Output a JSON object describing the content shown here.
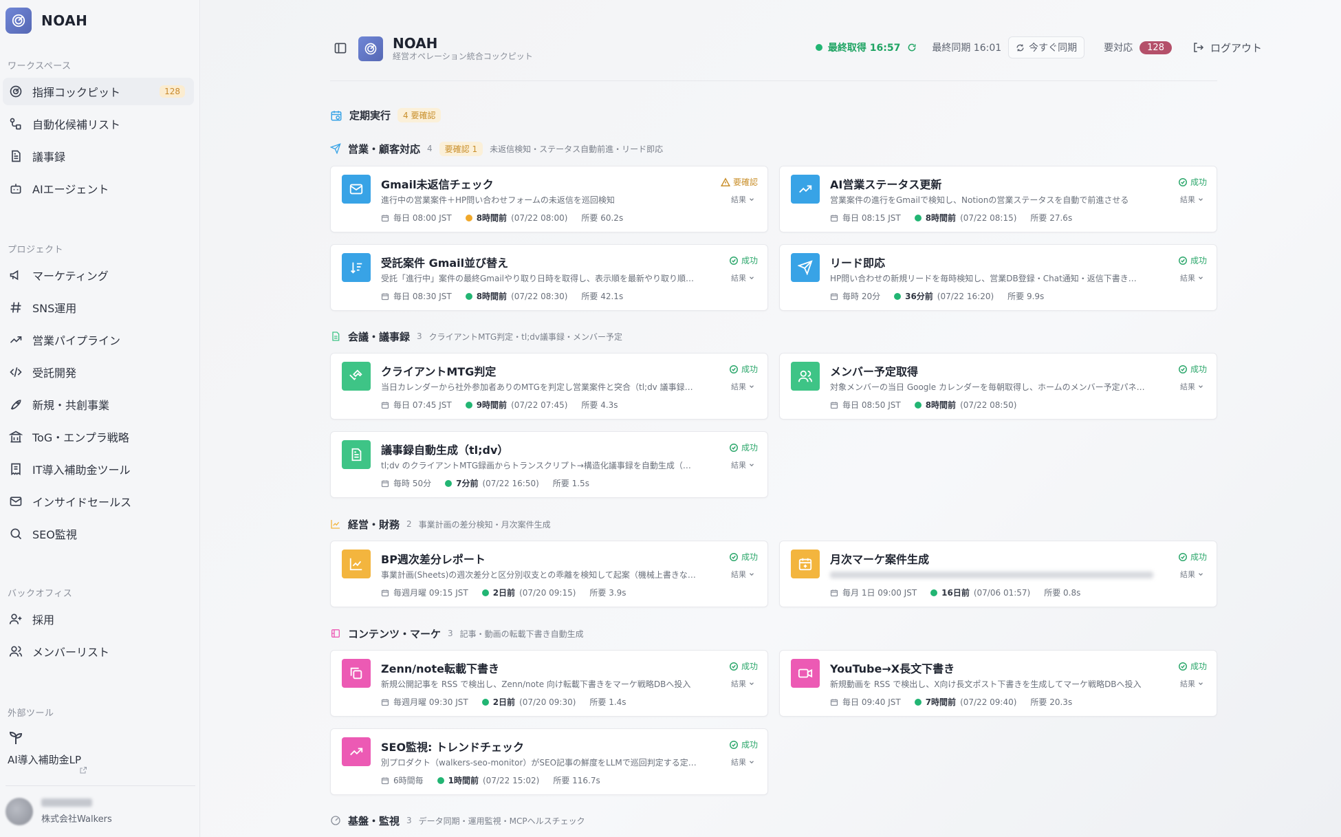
{
  "sidebar": {
    "brand": "NOAH",
    "sections": {
      "workspace": "ワークスペース",
      "project": "プロジェクト",
      "backoffice": "バックオフィス",
      "external": "外部ツール"
    },
    "workspace_items": [
      {
        "label": "指揮コックピット",
        "count": "128",
        "icon": "cockpit-icon"
      },
      {
        "label": "自動化候補リスト",
        "icon": "flow-icon"
      },
      {
        "label": "議事録",
        "icon": "document-icon"
      },
      {
        "label": "AIエージェント",
        "icon": "bot-icon"
      }
    ],
    "project_items": [
      {
        "label": "マーケティング",
        "icon": "megaphone-icon"
      },
      {
        "label": "SNS運用",
        "icon": "hash-icon"
      },
      {
        "label": "営業パイプライン",
        "icon": "trend-icon"
      },
      {
        "label": "受託開発",
        "icon": "code-icon"
      },
      {
        "label": "新規・共創事業",
        "icon": "rocket-icon"
      },
      {
        "label": "ToG・エンプラ戦略",
        "icon": "building-icon"
      },
      {
        "label": "IT導入補助金ツール",
        "icon": "receipt-icon"
      },
      {
        "label": "インサイドセールス",
        "icon": "mail-icon"
      },
      {
        "label": "SEO監視",
        "icon": "search-icon"
      }
    ],
    "backoffice_items": [
      {
        "label": "採用",
        "icon": "user-plus-icon"
      },
      {
        "label": "メンバーリスト",
        "icon": "users-icon"
      }
    ],
    "external_items": [
      {
        "label": "AI導入補助金LP",
        "icon": "sprout-icon"
      }
    ],
    "user": {
      "company": "株式会社Walkers"
    }
  },
  "header": {
    "title": "NOAH",
    "subtitle": "経営オペレーション統合コックピット",
    "last_fetch": "最終取得 16:57",
    "last_sync": "最終同期 16:01",
    "sync_now": "今すぐ同期",
    "needs_action_label": "要対応",
    "needs_action_count": "128",
    "logout": "ログアウト"
  },
  "schedule": {
    "title": "定期実行",
    "badge": "4 要確認"
  },
  "categories": [
    {
      "title": "営業・顧客対応",
      "count": "4",
      "badge": "要確認 1",
      "desc": "未返信検知・ステータス自動前進・リード即応"
    },
    {
      "title": "会議・議事録",
      "count": "3",
      "desc": "クライアントMTG判定・tl;dv議事録・メンバー予定"
    },
    {
      "title": "経営・財務",
      "count": "2",
      "desc": "事業計画の差分検知・月次案件生成"
    },
    {
      "title": "コンテンツ・マーケ",
      "count": "3",
      "desc": "記事・動画の転載下書き自動生成"
    },
    {
      "title": "基盤・監視",
      "count": "3",
      "desc": "データ同期・運用監視・MCPヘルスチェック"
    }
  ],
  "status": {
    "ok": "成功",
    "warn": "要確認",
    "result": "結果"
  },
  "cards": [
    {
      "title": "Gmail未返信チェック",
      "desc": "進行中の営業案件＋HP問い合わせフォームの未返信を巡回検知",
      "schedule": "毎日 08:00 JST",
      "last": "8時間前",
      "last_time": "(07/22 08:00)",
      "duration": "所要 60.2s",
      "status": "warn",
      "icon": "mail-icon",
      "color": "#38a3e6"
    },
    {
      "title": "AI営業ステータス更新",
      "desc": "営業案件の進行をGmailで検知し、Notionの営業ステータスを自動で前進させる",
      "schedule": "毎日 08:15 JST",
      "last": "8時間前",
      "last_time": "(07/22 08:15)",
      "duration": "所要 27.6s",
      "status": "ok",
      "icon": "trend-icon",
      "color": "#38a3e6"
    },
    {
      "title": "受託案件 Gmail並び替え",
      "desc": "受託「進行中」案件の最終Gmailやり取り日時を取得し、表示順を最新やり取り順…",
      "schedule": "毎日 08:30 JST",
      "last": "8時間前",
      "last_time": "(07/22 08:30)",
      "duration": "所要 42.1s",
      "status": "ok",
      "icon": "sort-icon",
      "color": "#38a3e6"
    },
    {
      "title": "リード即応",
      "desc": "HP問い合わせの新規リードを毎時検知し、営業DB登録・Chat通知・返信下書き…",
      "schedule": "毎時 20分",
      "last": "36分前",
      "last_time": "(07/22 16:20)",
      "duration": "所要 9.9s",
      "status": "ok",
      "icon": "send-icon",
      "color": "#38a3e6"
    },
    {
      "title": "クライアントMTG判定",
      "desc": "当日カレンダーから社外参加者ありのMTGを判定し営業案件と突合（tl;dv 議事録…",
      "schedule": "毎日 07:45 JST",
      "last": "9時間前",
      "last_time": "(07/22 07:45)",
      "duration": "所要 4.3s",
      "status": "ok",
      "icon": "handshake-icon",
      "color": "#3ec486"
    },
    {
      "title": "メンバー予定取得",
      "desc": "対象メンバーの当日 Google カレンダーを毎朝取得し、ホームのメンバー予定パネ…",
      "schedule": "毎日 08:50 JST",
      "last": "8時間前",
      "last_time": "(07/22 08:50)",
      "duration": "",
      "status": "ok",
      "icon": "users-icon",
      "color": "#3ec486"
    },
    {
      "title": "議事録自動生成（tl;dv）",
      "desc": "tl;dv のクライアントMTG録画からトランスクリプト→構造化議事録を自動生成（…",
      "schedule": "毎時 50分",
      "last": "7分前",
      "last_time": "(07/22 16:50)",
      "duration": "所要 1.5s",
      "status": "ok",
      "icon": "document-icon",
      "color": "#3ec486"
    },
    {
      "title": "BP週次差分レポート",
      "desc": "事業計画(Sheets)の週次差分と区分別収支との乖離を検知して起案（機械上書きな…",
      "schedule": "毎週月曜 09:15 JST",
      "last": "2日前",
      "last_time": "(07/20 09:15)",
      "duration": "所要 3.9s",
      "status": "ok",
      "icon": "chart-icon",
      "color": "#f3b53e"
    },
    {
      "title": "月次マーケ案件生成",
      "desc": "",
      "schedule": "毎月 1日 09:00 JST",
      "last": "16日前",
      "last_time": "(07/06 01:57)",
      "duration": "所要 0.8s",
      "status": "ok",
      "icon": "calendar-plus-icon",
      "color": "#f3b53e"
    },
    {
      "title": "Zenn/note転載下書き",
      "desc": "新規公開記事を RSS で検出し、Zenn/note 向け転載下書きをマーケ戦略DBへ投入",
      "schedule": "毎週月曜 09:30 JST",
      "last": "2日前",
      "last_time": "(07/20 09:30)",
      "duration": "所要 1.4s",
      "status": "ok",
      "icon": "copy-icon",
      "color": "#ec5ab4"
    },
    {
      "title": "YouTube→X長文下書き",
      "desc": "新規動画を RSS で検出し、X向け長文ポスト下書きを生成してマーケ戦略DBへ投入",
      "schedule": "毎日 09:40 JST",
      "last": "7時間前",
      "last_time": "(07/22 09:40)",
      "duration": "所要 20.3s",
      "status": "ok",
      "icon": "video-icon",
      "color": "#ec5ab4"
    },
    {
      "title": "SEO監視: トレンドチェック",
      "desc": "別プロダクト（walkers-seo-monitor）がSEO記事の鮮度をLLMで巡回判定する定…",
      "schedule": "6時間毎",
      "last": "1時間前",
      "last_time": "(07/22 15:02)",
      "duration": "所要 116.7s",
      "status": "ok",
      "icon": "trend-icon",
      "color": "#ec5ab4"
    }
  ]
}
